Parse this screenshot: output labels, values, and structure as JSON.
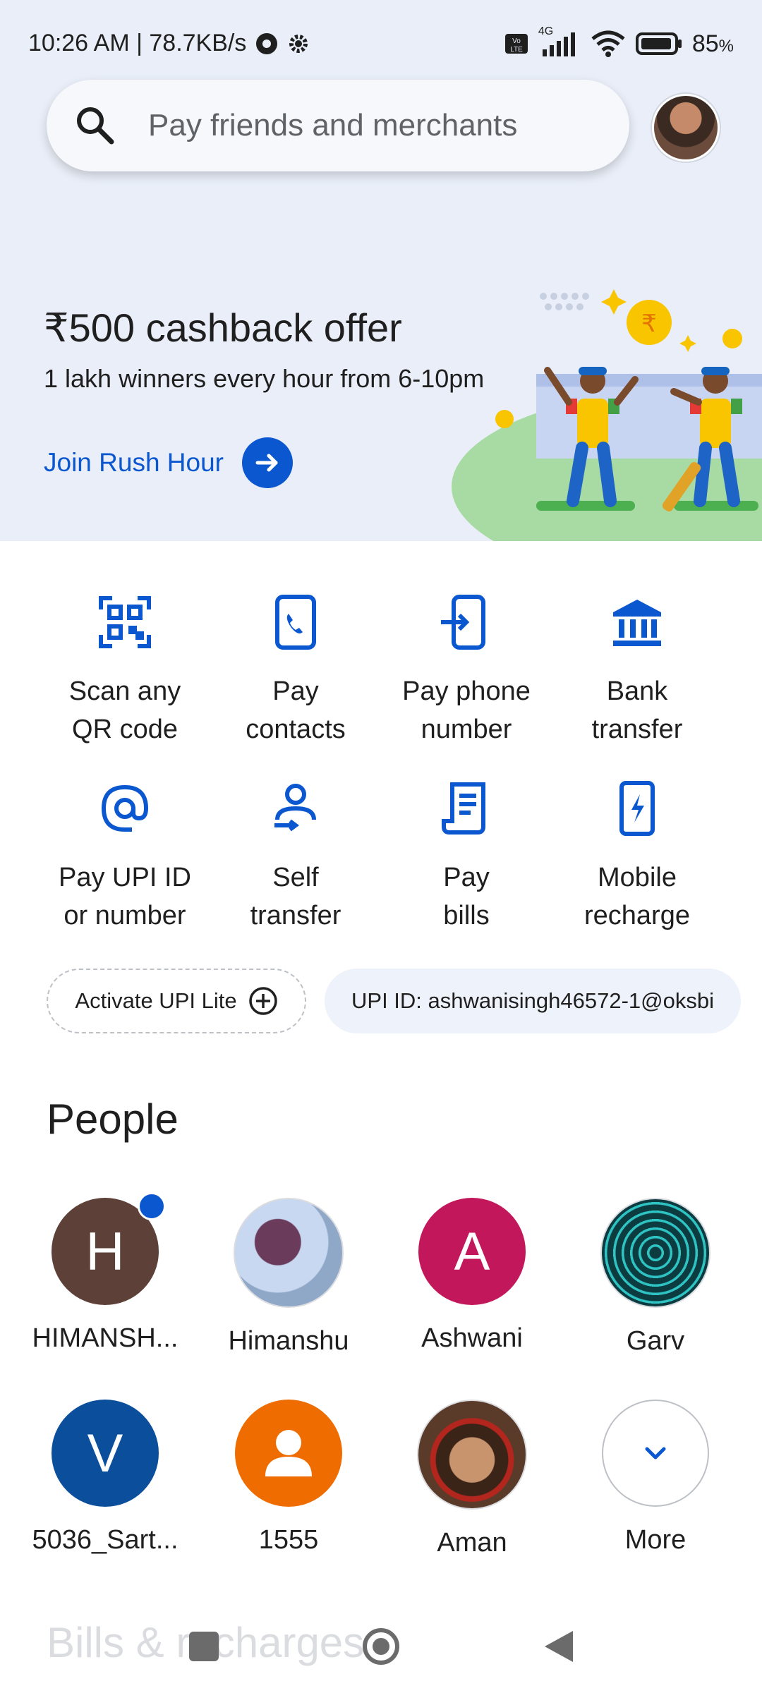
{
  "status_bar": {
    "time_speed": "10:26 AM | 78.7KB/s",
    "network": "4G",
    "volte": "Vo LTE",
    "battery": "85",
    "battery_unit": "%"
  },
  "search": {
    "placeholder": "Pay friends and merchants"
  },
  "promo": {
    "title": "₹500 cashback offer",
    "subtitle": "1 lakh winners every hour from 6-10pm",
    "link_label": "Join Rush Hour"
  },
  "actions": [
    {
      "line1": "Scan any",
      "line2": "QR code",
      "icon": "qr-scan-icon"
    },
    {
      "line1": "Pay",
      "line2": "contacts",
      "icon": "contacts-phone-icon"
    },
    {
      "line1": "Pay phone",
      "line2": "number",
      "icon": "phone-pay-icon"
    },
    {
      "line1": "Bank",
      "line2": "transfer",
      "icon": "bank-icon"
    },
    {
      "line1": "Pay UPI ID",
      "line2": "or number",
      "icon": "at-icon"
    },
    {
      "line1": "Self",
      "line2": "transfer",
      "icon": "self-transfer-icon"
    },
    {
      "line1": "Pay",
      "line2": "bills",
      "icon": "bill-icon"
    },
    {
      "line1": "Mobile",
      "line2": "recharge",
      "icon": "mobile-recharge-icon"
    }
  ],
  "chips": {
    "upi_lite": "Activate UPI Lite",
    "upi_id": "UPI ID: ashwanisingh46572-1@oksbi"
  },
  "people": {
    "title": "People",
    "items": [
      {
        "name": "HIMANSH...",
        "initial": "H",
        "color": "#5d4037"
      },
      {
        "name": "Himanshu",
        "initial": "",
        "color": "#8fa8c8"
      },
      {
        "name": "Ashwani",
        "initial": "A",
        "color": "#c2185b"
      },
      {
        "name": "Garv",
        "initial": "",
        "color": "#0c3b40"
      },
      {
        "name": "5036_Sart...",
        "initial": "V",
        "color": "#0b4f9c"
      },
      {
        "name": "1555",
        "initial": "",
        "color": "#ef6c00"
      },
      {
        "name": "Aman",
        "initial": "",
        "color": "#7a4a2c"
      },
      {
        "name": "More",
        "initial": "",
        "color": "#ffffff"
      }
    ]
  },
  "bills": {
    "title": "Bills & recharges"
  },
  "colors": {
    "accent": "#0b57d0",
    "header_bg": "#e9eef8"
  }
}
